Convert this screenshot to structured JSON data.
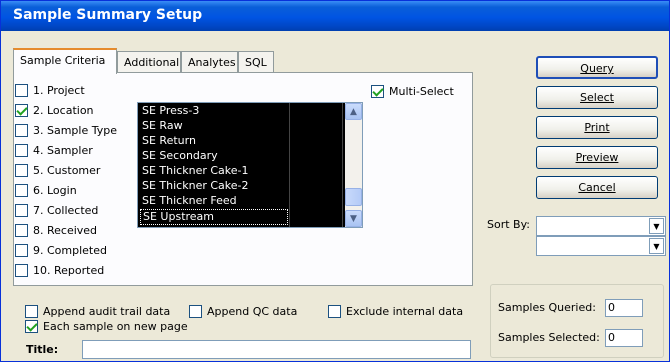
{
  "window": {
    "title": "Sample Summary Setup"
  },
  "tabs": [
    "Sample Criteria",
    "Additional",
    "Analytes",
    "SQL"
  ],
  "criteria": [
    {
      "label": "1. Project",
      "checked": false
    },
    {
      "label": "2. Location",
      "checked": true
    },
    {
      "label": "3. Sample Type",
      "checked": false
    },
    {
      "label": "4. Sampler",
      "checked": false
    },
    {
      "label": "5. Customer",
      "checked": false
    },
    {
      "label": "6. Login",
      "checked": false
    },
    {
      "label": "7. Collected",
      "checked": false
    },
    {
      "label": "8. Received",
      "checked": false
    },
    {
      "label": "9. Completed",
      "checked": false
    },
    {
      "label": "10. Reported",
      "checked": false
    }
  ],
  "multi_select": {
    "label": "Multi-Select",
    "checked": true
  },
  "locations": [
    "SE Press-3",
    "SE Raw",
    "SE Return",
    "SE Secondary",
    "SE Thickner Cake-1",
    "SE Thickner Cake-2",
    "SE Thickner Feed",
    "SE Upstream"
  ],
  "buttons": {
    "query": "Query",
    "select": "Select",
    "print": "Print",
    "preview": "Preview",
    "cancel": "Cancel"
  },
  "sort_by_label": "Sort By:",
  "sort_by_1": "",
  "sort_by_2": "",
  "options": {
    "append_audit": "Append audit trail data",
    "append_qc": "Append QC data",
    "exclude_internal": "Exclude internal data",
    "each_sample_page": "Each sample on new page"
  },
  "options_checked": {
    "append_audit": false,
    "append_qc": false,
    "exclude_internal": false,
    "each_sample_page": true
  },
  "stats": {
    "queried_label": "Samples Queried:",
    "queried_value": "0",
    "selected_label": "Samples Selected:",
    "selected_value": "0"
  },
  "title_field": {
    "label": "Title:",
    "value": ""
  },
  "colors": {
    "titlebar": "#0054e3",
    "dialog": "#ece9d8",
    "listbox_bg": "#000000"
  }
}
